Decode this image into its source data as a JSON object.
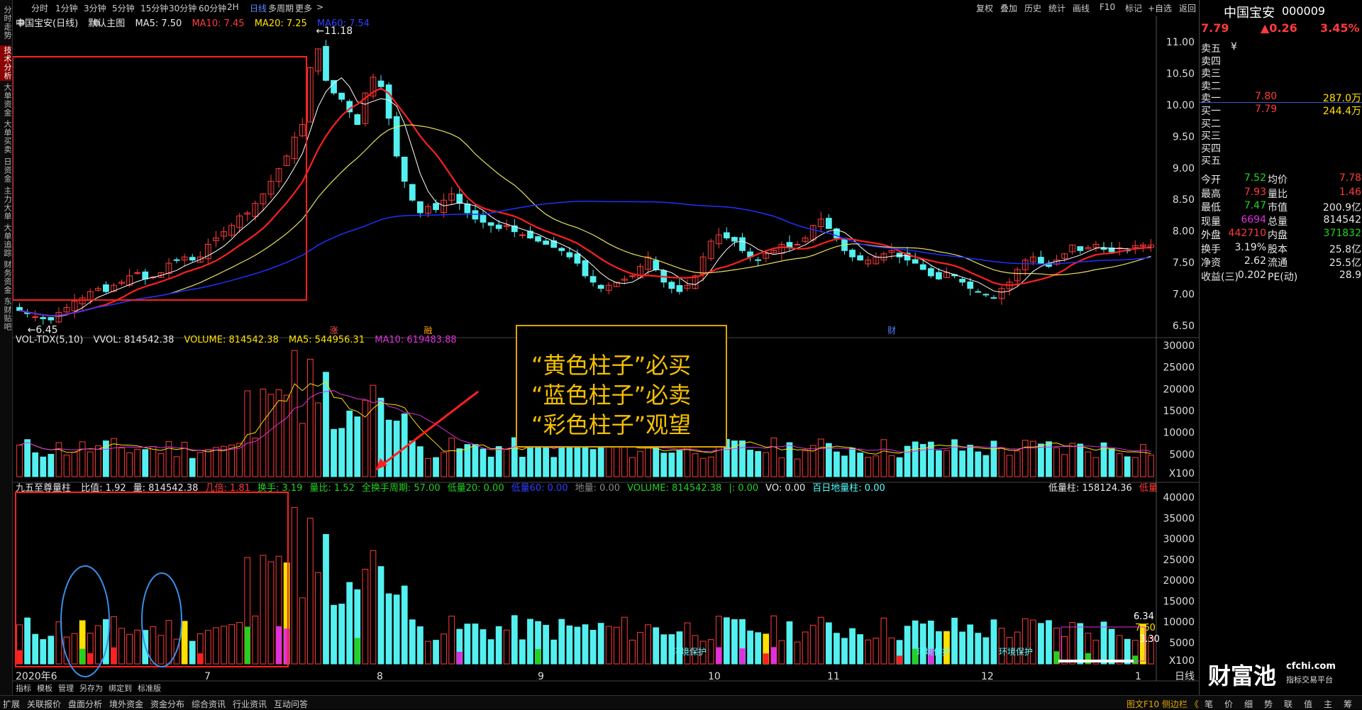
{
  "left_tabs": [
    "分时走势",
    "技术分析",
    "大单资金",
    "大单买卖",
    "日资金",
    "主力大单",
    "大单追踪",
    "财务资金",
    "东财贴吧"
  ],
  "toolbar": {
    "periods": [
      "分时",
      "1分钟",
      "3分钟",
      "5分钟",
      "15分钟",
      "30分钟",
      "60分钟",
      "2H",
      "日线",
      "多周期",
      "更多"
    ],
    "active_period": "日线",
    "right_items": [
      "复权",
      "叠加",
      "历史",
      "统计",
      "画线",
      "F10",
      "标记",
      "+自选",
      "返回"
    ]
  },
  "main_chart": {
    "title": "中国宝安(日线)",
    "template": "默认主图",
    "ma5": "MA5: 7.50",
    "ma10": "MA10: 7.45",
    "ma20": "MA20: 7.25",
    "ma60": "MA60: 7.54",
    "high_label": "11.18",
    "low_label": "6.45",
    "y_ticks": [
      "11.00",
      "10.50",
      "10.00",
      "9.50",
      "9.00",
      "8.50",
      "8.00",
      "7.50",
      "7.00",
      "6.50"
    ],
    "event_labels": [
      "涨",
      "融",
      "$",
      "财"
    ]
  },
  "vol_chart": {
    "title": "VOL-TDX(5,10)",
    "vvol": "VVOL: 814542.38",
    "volume": "VOLUME: 814542.38",
    "ma5": "MA5: 544956.31",
    "ma10": "MA10: 619483.88",
    "y_ticks": [
      "30000",
      "25000",
      "20000",
      "15000",
      "10000",
      "5000",
      "X100"
    ]
  },
  "ind_chart": {
    "title": "九五至尊量柱",
    "items": [
      {
        "text": "比值: 1.92",
        "color": "#e8e8e8"
      },
      {
        "text": "量: 814542.38",
        "color": "#e8e8e8"
      },
      {
        "text": "几倍: 1.81",
        "color": "#ff3b3b"
      },
      {
        "text": "换手: 3.19",
        "color": "#21d321"
      },
      {
        "text": "量比: 1.52",
        "color": "#21d321"
      },
      {
        "text": "全换手周期: 57.00",
        "color": "#21d321"
      },
      {
        "text": "低量20: 0.00",
        "color": "#21d321"
      },
      {
        "text": "低量60: 0.00",
        "color": "#3040ff"
      },
      {
        "text": "地量: 0.00",
        "color": "#888888"
      },
      {
        "text": "VOLUME: 814542.38",
        "color": "#21d321"
      },
      {
        "text": "|: 0.00",
        "color": "#21d321"
      },
      {
        "text": "VO: 0.00",
        "color": "#e8e8e8"
      },
      {
        "text": "百日地量柱: 0.00",
        "color": "#5ff"
      }
    ],
    "low_bar": "低量柱: 158124.36",
    "low_tail": "低量",
    "y_ticks": [
      "40000",
      "35000",
      "30000",
      "25000",
      "20000",
      "15000",
      "10000",
      "5000",
      "X100"
    ],
    "labels": [
      "6.34",
      "7.60",
      "3.30"
    ],
    "inline_labels": [
      "环境保护",
      "环境保护",
      "环境保护"
    ],
    "x_axis": [
      "2020年6",
      "7",
      "8",
      "9",
      "10",
      "11",
      "12",
      "1"
    ],
    "x_unit": "日线"
  },
  "annotation": {
    "line1": "“黄色柱子”必买",
    "line2": "“蓝色柱子”必卖",
    "line3": "“彩色柱子”观望"
  },
  "quote_panel": {
    "name": "中国宝安",
    "code": "000009",
    "price": "7.79",
    "change": "▲0.26",
    "pct": "3.45%",
    "book": [
      {
        "label": "卖五",
        "price": "",
        "vol": ""
      },
      {
        "label": "卖四",
        "price": "",
        "vol": ""
      },
      {
        "label": "卖三",
        "price": "",
        "vol": ""
      },
      {
        "label": "卖二",
        "price": "",
        "vol": ""
      },
      {
        "label": "卖一",
        "price": "7.80",
        "vol": "287.0万"
      },
      {
        "label": "买一",
        "price": "7.79",
        "vol": "244.4万"
      },
      {
        "label": "买二",
        "price": "",
        "vol": ""
      },
      {
        "label": "买三",
        "price": "",
        "vol": ""
      },
      {
        "label": "买四",
        "price": "",
        "vol": ""
      },
      {
        "label": "买五",
        "price": "",
        "vol": ""
      }
    ],
    "currency": "¥",
    "stats": [
      {
        "l1": "今开",
        "v1": "7.52",
        "l2": "均价",
        "v2": "7.78",
        "c1": "#21d321",
        "c2": "#ff3b3b"
      },
      {
        "l1": "最高",
        "v1": "7.93",
        "l2": "量比",
        "v2": "1.46",
        "c1": "#ff3b3b",
        "c2": "#ff3b3b"
      },
      {
        "l1": "最低",
        "v1": "7.47",
        "l2": "市值",
        "v2": "200.9亿",
        "c1": "#21d321",
        "c2": "#e8e8e8"
      },
      {
        "l1": "现量",
        "v1": "6694",
        "l2": "总量",
        "v2": "814542",
        "c1": "#e030e0",
        "c2": "#e8e8e8"
      },
      {
        "l1": "外盘",
        "v1": "442710",
        "l2": "内盘",
        "v2": "371832",
        "c1": "#ff3b3b",
        "c2": "#21d321"
      },
      {
        "l1": "换手",
        "v1": "3.19%",
        "l2": "股本",
        "v2": "25.8亿",
        "c1": "#e8e8e8",
        "c2": "#e8e8e8"
      },
      {
        "l1": "净资",
        "v1": "2.62",
        "l2": "流通",
        "v2": "25.5亿",
        "c1": "#e8e8e8",
        "c2": "#e8e8e8"
      },
      {
        "l1": "收益(三)",
        "v1": "0.202",
        "l2": "PE(动)",
        "v2": "28.9",
        "c1": "#e8e8e8",
        "c2": "#e8e8e8"
      }
    ]
  },
  "bottom_bar": {
    "left": [
      "扩展",
      "关联报价",
      "盘面分析",
      "境外资金",
      "资金分布",
      "综合资讯",
      "行业资讯",
      "互动问答"
    ],
    "lower": [
      "指标",
      "模板",
      "管理",
      "另存为",
      "绑定到",
      "标准版"
    ],
    "right": "图文F10 侧边栏 《",
    "panel": [
      "笔",
      "价",
      "细",
      "势",
      "联",
      "值",
      "主",
      "筹"
    ]
  },
  "watermark": {
    "brand": "财富池",
    "site": "cfchi.com",
    "sub": "指标交易平台"
  },
  "colors": {
    "up": "#ff3b3b",
    "down": "#54f0f0",
    "ma5": "#ffffff",
    "ma10": "#ff2020",
    "ma20": "#e6e060",
    "ma60": "#2030ff",
    "highlight_box": "#ff2020",
    "circle": "#3a8ee8",
    "annotation_border": "#e0a300"
  }
}
